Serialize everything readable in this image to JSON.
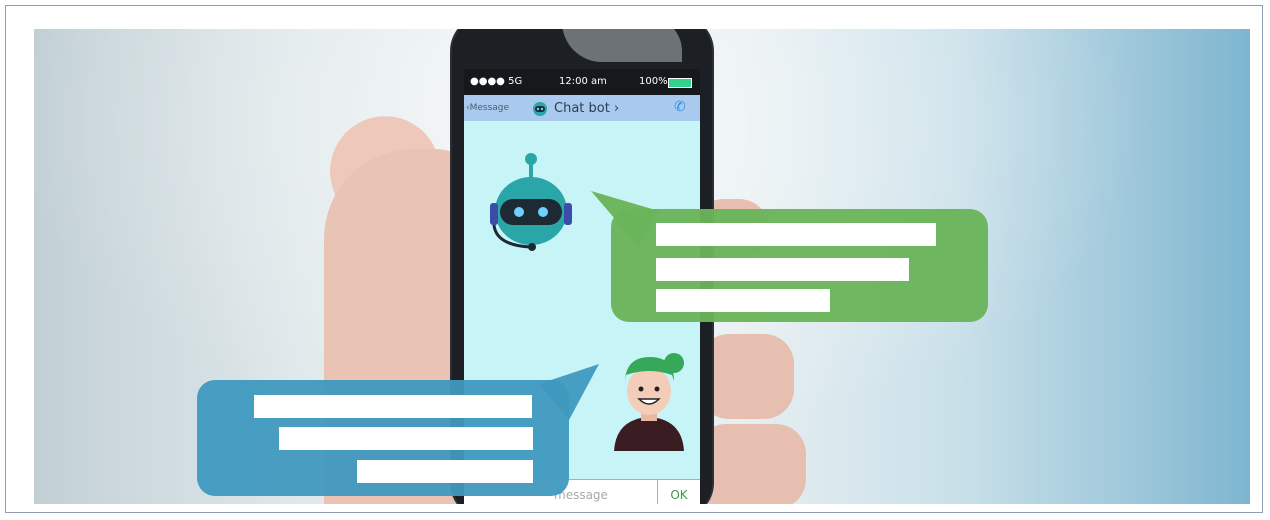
{
  "phone": {
    "status": {
      "signal": "●●●● 5G",
      "time": "12:00 am",
      "battery": "100%"
    },
    "nav": {
      "back": "‹Message",
      "title": "Chat bot ›",
      "call_icon": "phone-icon"
    },
    "input": {
      "placeholder": "message",
      "ok": "OK"
    }
  },
  "colors": {
    "green_bubble": "#6ab45a",
    "blue_bubble": "#3f99bf",
    "screen": "#c7f5f7",
    "navbar": "#a9c9ee"
  },
  "icons": [
    "robot-icon",
    "user-avatar-icon",
    "phone-icon"
  ]
}
